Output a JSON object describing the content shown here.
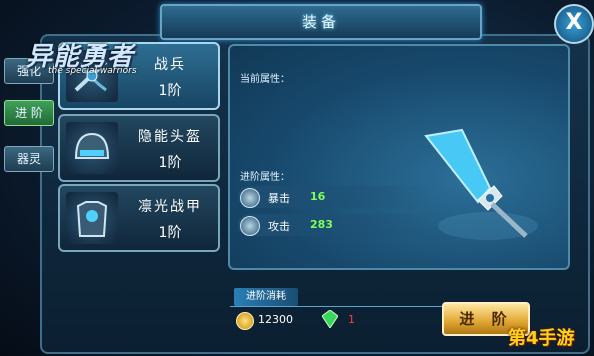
{
  "window": {
    "title": "装备",
    "close_label": "X"
  },
  "logo": {
    "title_cn": "异能勇者",
    "title_en": "the special warriors"
  },
  "tabs": [
    {
      "label": "强化",
      "active": false
    },
    {
      "label": "进 阶",
      "active": true
    },
    {
      "label": "器灵",
      "active": false
    }
  ],
  "equipment": [
    {
      "name": "战兵",
      "level": "1阶",
      "selected": true,
      "icon": "crossbow-icon"
    },
    {
      "name": "隐能头盔",
      "level": "1阶",
      "selected": false,
      "icon": "helmet-icon"
    },
    {
      "name": "凛光战甲",
      "level": "1阶",
      "selected": false,
      "icon": "armor-icon"
    }
  ],
  "panel": {
    "current_label": "当前属性：",
    "advance_label": "进阶属性：",
    "stats": [
      {
        "key": "暴击",
        "value": "16"
      },
      {
        "key": "攻击",
        "value": "283"
      }
    ]
  },
  "cost": {
    "header": "进阶消耗",
    "gold": "12300",
    "gem": "1"
  },
  "advance_button": "进 阶",
  "watermark": "第4手游",
  "colors": {
    "accent": "#2b8bcf",
    "stat_value": "#7cff5c",
    "gem_value": "#ff3a3a",
    "button": "#e0a630"
  }
}
